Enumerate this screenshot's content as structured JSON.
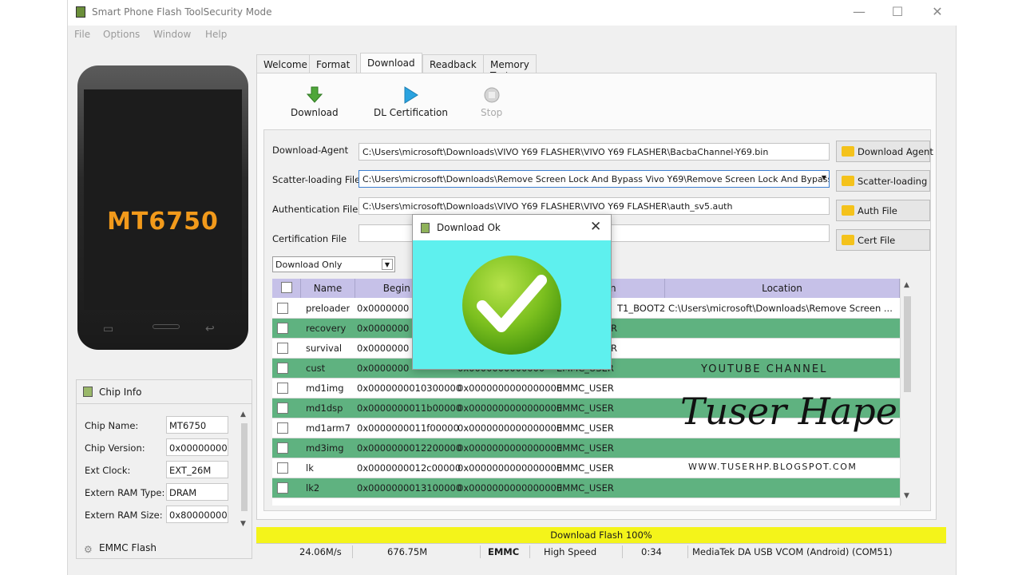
{
  "window": {
    "title": "Smart Phone Flash ToolSecurity Mode",
    "minimize": "—",
    "maximize": "☐",
    "close": "✕"
  },
  "menu": [
    "File",
    "Options",
    "Window",
    "Help"
  ],
  "phone": {
    "model": "MT6750"
  },
  "chip_info": {
    "header": "Chip Info",
    "rows": [
      {
        "label": "Chip Name:",
        "value": "MT6750"
      },
      {
        "label": "Chip Version:",
        "value": "0x00000000"
      },
      {
        "label": "Ext Clock:",
        "value": "EXT_26M"
      },
      {
        "label": "Extern RAM Type:",
        "value": "DRAM"
      },
      {
        "label": "Extern RAM Size:",
        "value": "0x80000000"
      }
    ],
    "footer": "EMMC Flash"
  },
  "tabs": [
    "Welcome",
    "Format",
    "Download",
    "Readback",
    "Memory Test"
  ],
  "active_tab": "Download",
  "toolbar": {
    "download": "Download",
    "dl_cert": "DL Certification",
    "stop": "Stop"
  },
  "form": {
    "download_agent": {
      "label": "Download-Agent",
      "value": "C:\\Users\\microsoft\\Downloads\\VIVO Y69 FLASHER\\VIVO Y69 FLASHER\\BacbaChannel-Y69.bin",
      "button": "Download Agent"
    },
    "scatter": {
      "label": "Scatter-loading File",
      "value": "C:\\Users\\microsoft\\Downloads\\Remove Screen Lock And Bypass Vivo Y69\\Remove Screen Lock And Bypass Vi",
      "button": "Scatter-loading"
    },
    "auth": {
      "label": "Authentication File",
      "value": "C:\\Users\\microsoft\\Downloads\\VIVO Y69 FLASHER\\VIVO Y69 FLASHER\\auth_sv5.auth",
      "button": "Auth File"
    },
    "cert": {
      "label": "Certification File",
      "value": "",
      "button": "Cert File"
    },
    "mode": "Download Only"
  },
  "table": {
    "headers": [
      "Name",
      "Begin Ad",
      "",
      "ion",
      "Location"
    ],
    "rows": [
      {
        "name": "preloader",
        "begin": "0x0000000",
        "end": "",
        "region": "T1_BOOT2",
        "location": "C:\\Users\\microsoft\\Downloads\\Remove Screen ..."
      },
      {
        "name": "recovery",
        "begin": "0x0000000",
        "end": "",
        "region": "R",
        "location": ""
      },
      {
        "name": "survival",
        "begin": "0x0000000",
        "end": "",
        "region": "R",
        "location": ""
      },
      {
        "name": "cust",
        "begin": "0x0000000",
        "end": "0x0000000000000",
        "region": "EMMC_USER",
        "location": ""
      },
      {
        "name": "md1img",
        "begin": "0x0000000010300000",
        "end": "0x0000000000000000",
        "region": "EMMC_USER",
        "location": ""
      },
      {
        "name": "md1dsp",
        "begin": "0x0000000011b00000",
        "end": "0x0000000000000000",
        "region": "EMMC_USER",
        "location": ""
      },
      {
        "name": "md1arm7",
        "begin": "0x0000000011f00000",
        "end": "0x0000000000000000",
        "region": "EMMC_USER",
        "location": ""
      },
      {
        "name": "md3img",
        "begin": "0x0000000012200000",
        "end": "0x0000000000000000",
        "region": "EMMC_USER",
        "location": ""
      },
      {
        "name": "lk",
        "begin": "0x0000000012c00000",
        "end": "0x0000000000000000",
        "region": "EMMC_USER",
        "location": ""
      },
      {
        "name": "lk2",
        "begin": "0x0000000013100000",
        "end": "0x0000000000000000",
        "region": "EMMC_USER",
        "location": ""
      }
    ]
  },
  "progress": {
    "label": "Download Flash 100%",
    "fraction": 1.0
  },
  "status": {
    "speed": "24.06M/s",
    "size": "676.75M",
    "storage": "EMMC",
    "mode": "High Speed",
    "time": "0:34",
    "port": "MediaTek DA USB VCOM (Android) (COM51)"
  },
  "dialog": {
    "title": "Download Ok",
    "close": "✕"
  },
  "watermark": {
    "title": "YOUTUBE CHANNEL",
    "name": "Tuser Hape",
    "url": "WWW.TUSERHP.BLOGSPOT.COM"
  },
  "colors": {
    "progress": "#f4f41a",
    "green_row": "#5fb280",
    "dialog_bg": "#5ef0ee",
    "header_bg": "#c6c1e8",
    "phone_model": "#f29a1b"
  }
}
